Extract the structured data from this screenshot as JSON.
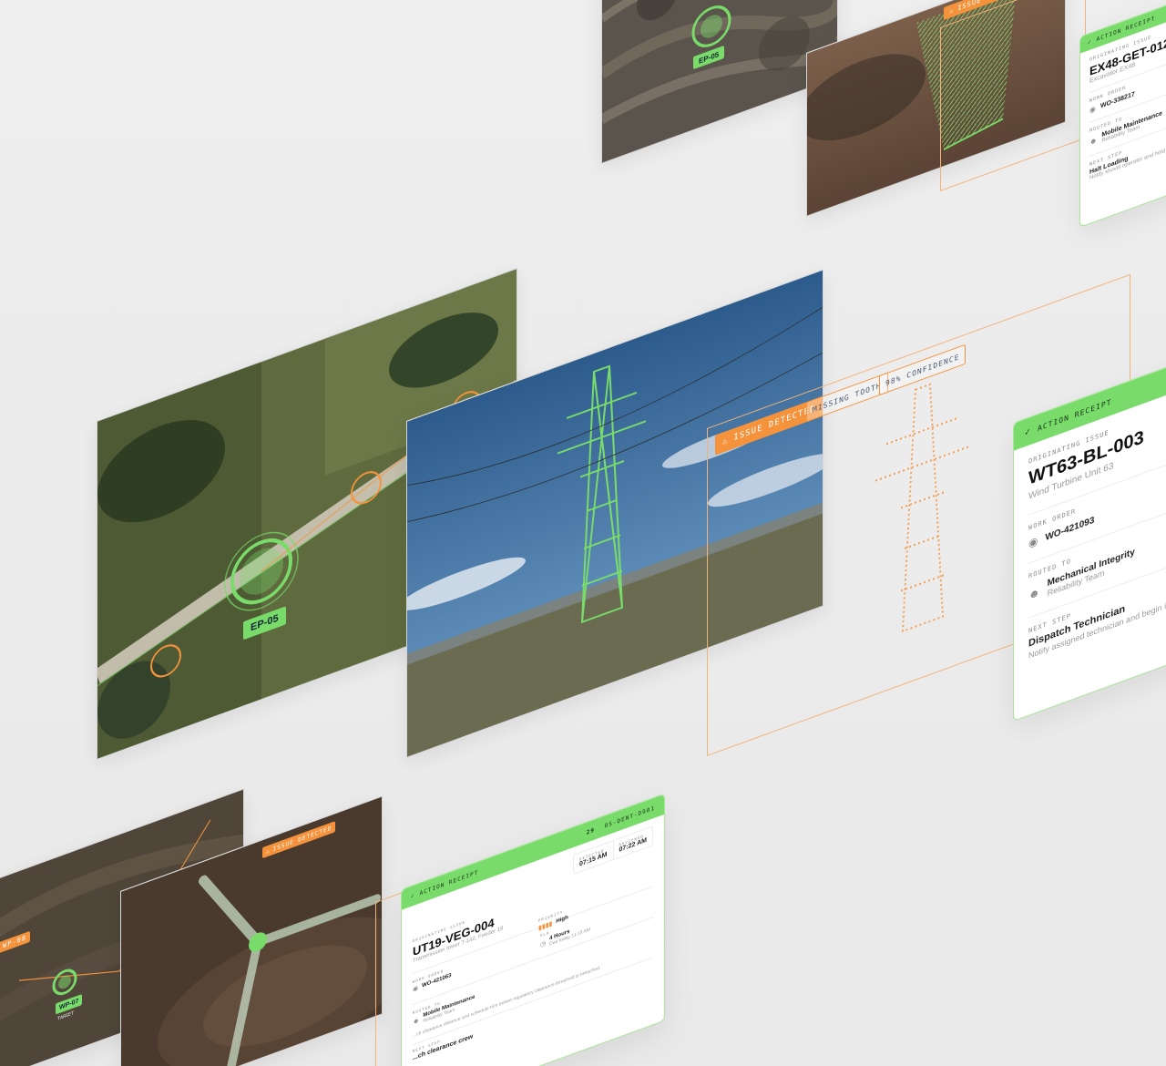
{
  "top_card": {
    "map_marker_label": "EP-05",
    "issue_tag": "ISSUE DETECTED",
    "receipt": {
      "header": "ACTION RECEIPT",
      "originating_label": "ORIGINATING ISSUE",
      "issue_id": "EX48-GET-012",
      "issue_sub": "Excavator EX48",
      "work_order_label": "WORK ORDER",
      "work_order": "WO-338217",
      "routed_label": "ROUTED TO",
      "routed_to": "Mobile Maintenance",
      "routed_team": "Reliability Team",
      "next_label": "NEXT STEP",
      "next_step": "Halt Loading",
      "next_desc": "Notify shovel operator and hold s"
    }
  },
  "middle_card": {
    "map_marker_label": "EP-05",
    "issue_tag": "ISSUE DETECTED",
    "tag_missing": "MISSING TOOTH",
    "tag_confidence": "98% CONFIDENCE",
    "receipt": {
      "header": "ACTION RECEIPT",
      "originating_label": "ORIGINATING ISSUE",
      "issue_id": "WT63-BL-003",
      "issue_sub": "Wind Turbine Unit 63",
      "work_order_label": "WORK ORDER",
      "work_order": "WO-421093",
      "routed_label": "ROUTED TO",
      "routed_to": "Mechanical Integrity",
      "routed_team": "Reliability Team",
      "next_label": "NEXT STEP",
      "next_step": "Dispatch Technician",
      "next_desc": "Notify assigned technician and begin i"
    }
  },
  "bottom_card": {
    "map_label_1": "WP-08",
    "map_label_2": "WP-07",
    "map_label_3": "TARGET",
    "issue_tag": "ISSUE DETECTED",
    "receipt": {
      "header": "ACTION RECEIPT",
      "header_right_num": "29",
      "header_right_code": "0S-DENT-D901",
      "detected_label": "DETECTED",
      "detected_time": "07:15 AM",
      "reviewed_label": "REVIEWED",
      "reviewed_time": "07:22 AM",
      "originating_label": "ORIGINATING ISSUE",
      "issue_id": "UT19-VEG-004",
      "issue_sub": "Transmission tower T-142, Feeder 19",
      "priority_label": "PRIORITY",
      "priority": "High",
      "work_order_label": "WORK ORDER",
      "work_order": "WO-421063",
      "sla_label": "SLA",
      "sla": "4 Hours",
      "sla_due": "Due today 11:15 AM",
      "routed_label": "ROUTED TO",
      "routed_to": "Mobile Maintenance",
      "routed_team": "Reliability Team",
      "next_desc": "...ch clearance distance and schedule trim before regulatory clearance threshold is breached.",
      "next_label": "NEXT STEP",
      "next_step": "...ch clearance crew"
    }
  },
  "colors": {
    "accent_green": "#79dc6a",
    "accent_orange": "#f5933c",
    "background": "#ececec"
  }
}
